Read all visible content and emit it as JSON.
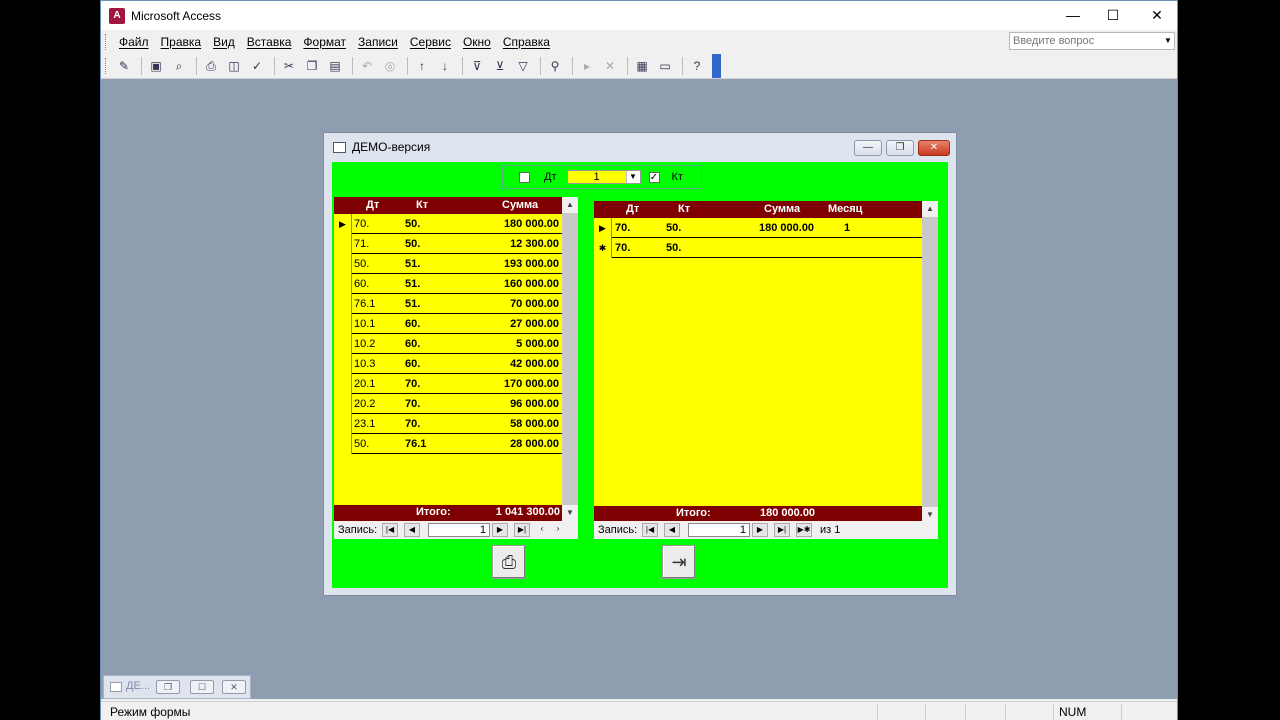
{
  "window": {
    "title": "Microsoft Access",
    "icon": "access-icon"
  },
  "menu": [
    "Файл",
    "Правка",
    "Вид",
    "Вставка",
    "Формат",
    "Записи",
    "Сервис",
    "Окно",
    "Справка"
  ],
  "help_box": {
    "placeholder": "Введите вопрос"
  },
  "form": {
    "title": "ДЕМО-версия",
    "filter": {
      "dt_label": "Дт",
      "kt_label": "Кт",
      "combo_value": "1",
      "dt_checked": false,
      "kt_checked": true
    },
    "left_grid": {
      "headers": [
        "Дт",
        "Кт",
        "Сумма"
      ],
      "rows": [
        {
          "dt": "70.",
          "kt": "50.",
          "sum": "180 000.00"
        },
        {
          "dt": "71.",
          "kt": "50.",
          "sum": "12 300.00"
        },
        {
          "dt": "50.",
          "kt": "51.",
          "sum": "193 000.00"
        },
        {
          "dt": "60.",
          "kt": "51.",
          "sum": "160 000.00"
        },
        {
          "dt": "76.1",
          "kt": "51.",
          "sum": "70 000.00"
        },
        {
          "dt": "10.1",
          "kt": "60.",
          "sum": "27 000.00"
        },
        {
          "dt": "10.2",
          "kt": "60.",
          "sum": "5 000.00"
        },
        {
          "dt": "10.3",
          "kt": "60.",
          "sum": "42 000.00"
        },
        {
          "dt": "20.1",
          "kt": "70.",
          "sum": "170 000.00"
        },
        {
          "dt": "20.2",
          "kt": "70.",
          "sum": "96 000.00"
        },
        {
          "dt": "23.1",
          "kt": "70.",
          "sum": "58 000.00"
        },
        {
          "dt": "50.",
          "kt": "76.1",
          "sum": "28 000.00"
        }
      ],
      "total_label": "Итого:",
      "total_value": "1 041 300.00",
      "nav_label": "Запись:",
      "nav_value": "1"
    },
    "right_grid": {
      "headers": [
        "Дт",
        "Кт",
        "Сумма",
        "Месяц"
      ],
      "rows": [
        {
          "marker": "▶",
          "dt": "70.",
          "kt": "50.",
          "sum": "180 000.00",
          "month": "1"
        },
        {
          "marker": "✱",
          "dt": "70.",
          "kt": "50.",
          "sum": "",
          "month": ""
        }
      ],
      "total_label": "Итого:",
      "total_value": "180 000.00",
      "nav_label": "Запись:",
      "nav_value": "1",
      "nav_of": "из 1"
    }
  },
  "minimized": {
    "label": "ДЕ..."
  },
  "status": {
    "mode": "Режим формы",
    "num": "NUM"
  }
}
